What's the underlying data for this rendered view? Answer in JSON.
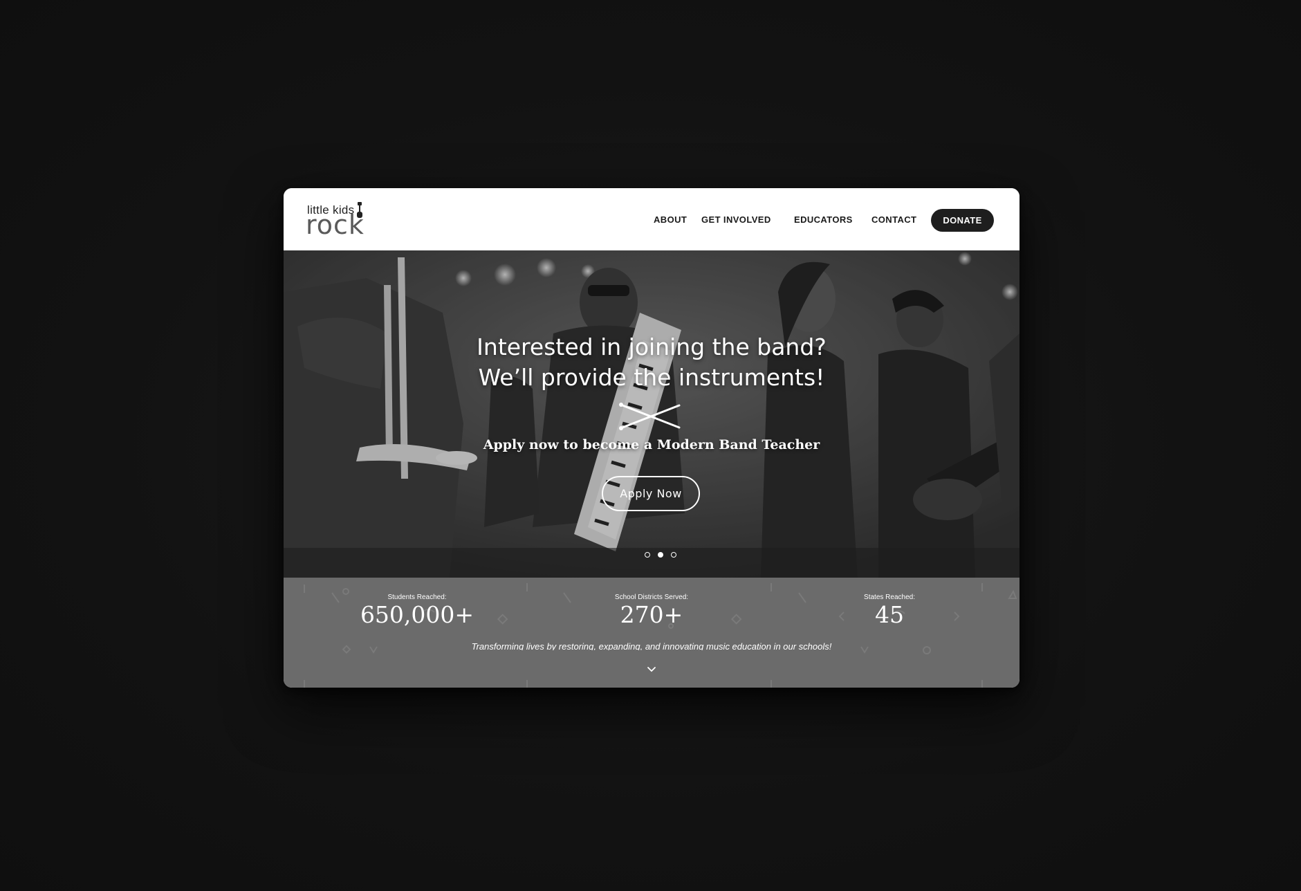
{
  "site": {
    "logo_small": "little kids",
    "logo_big": "rock"
  },
  "nav": {
    "items": [
      {
        "label": "ABOUT"
      },
      {
        "label": "GET INVOLVED"
      },
      {
        "label": "EDUCATORS"
      },
      {
        "label": "CONTACT"
      }
    ],
    "donate_label": "DONATE"
  },
  "hero": {
    "title_line1": "Interested in joining the band?",
    "title_line2": "We’ll provide the instruments!",
    "subtitle": "Apply now to become a Modern Band Teacher",
    "cta_label": "Apply  Now",
    "slides": 3,
    "active_slide": 2
  },
  "stats": {
    "items": [
      {
        "label": "Students Reached:",
        "value": "650,000+"
      },
      {
        "label": "School Districts Served:",
        "value": "270+"
      },
      {
        "label": "States Reached:",
        "value": "45"
      }
    ],
    "tagline": "Transforming lives by restoring, expanding, and innovating music education in our schools!"
  },
  "colors": {
    "backdrop": "#121212",
    "header_bg": "#ffffff",
    "donate_bg": "#1e1e1e",
    "stats_bg": "#6b6b6b",
    "hero_text": "#ffffff"
  },
  "icons": {
    "drumsticks": "crossed-drumsticks-icon",
    "scroll": "chevron-down-icon",
    "logo_guitar": "guitar-icon"
  }
}
